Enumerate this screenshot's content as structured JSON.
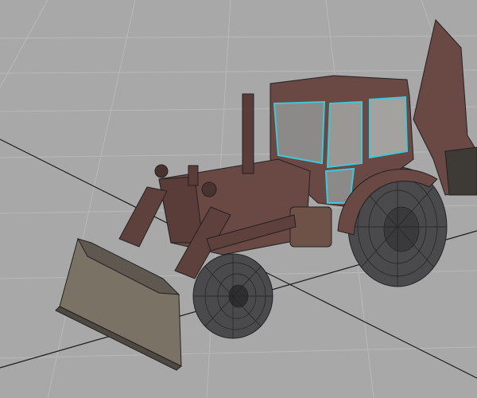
{
  "scene": {
    "subject": "backhoe-loader-tractor",
    "colors": {
      "background": "#a8a8a8",
      "grid": "#b8b8b8",
      "axis": "#1a1a1a",
      "body": "#6a4844",
      "body_dark": "#4a3230",
      "tire": "#4a4a4c",
      "wire": "#222222",
      "glass_edge": "#3ec8d8",
      "bucket": "#7a7264"
    }
  }
}
